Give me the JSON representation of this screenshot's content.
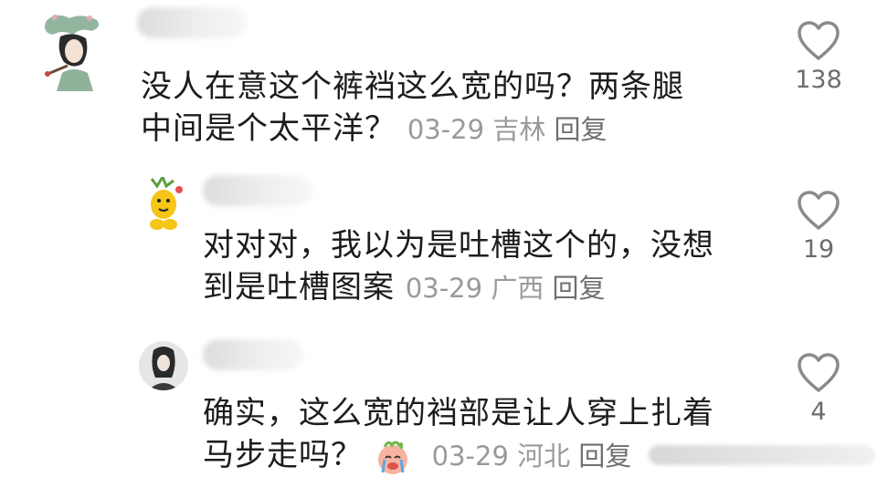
{
  "comments": [
    {
      "text_line1": "没人在意这个裤裆这么宽的吗？两条腿",
      "text_line2": "中间是个太平洋？",
      "date": "03-29",
      "location": "吉林",
      "reply_label": "回复",
      "likes": "138"
    },
    {
      "text_line1": "对对对，我以为是吐槽这个的，没想",
      "text_line2": "到是吐槽图案",
      "date": "03-29",
      "location": "广西",
      "reply_label": "回复",
      "likes": "19"
    },
    {
      "text_line1": "确实，这么宽的裆部是让人穿上扎着",
      "text_line2": "马步走吗？",
      "date": "03-29",
      "location": "河北",
      "reply_label": "回复",
      "likes": "4"
    }
  ],
  "icons": {
    "like": "heart-outline-icon",
    "emoji": "crying-face-emoji-icon"
  },
  "colors": {
    "text": "#1c1c1c",
    "meta": "#9a9a9a",
    "reply": "#6f6f6f",
    "icon": "#8a8a8a"
  }
}
